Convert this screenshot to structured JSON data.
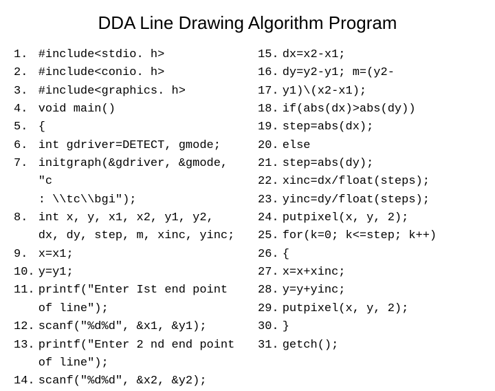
{
  "title": "DDA Line Drawing Algorithm Program",
  "left": [
    {
      "n": "1",
      "code": "#include<stdio. h>"
    },
    {
      "n": "2",
      "code": "#include<conio. h>"
    },
    {
      "n": "3",
      "code": "#include<graphics. h>"
    },
    {
      "n": "4",
      "code": "void main()"
    },
    {
      "n": "5",
      "code": "{"
    },
    {
      "n": "6",
      "code": "int gdriver=DETECT, gmode;"
    },
    {
      "n": "7",
      "code": "initgraph(&gdriver, &gmode, \"c",
      "cont": ": \\\\tc\\\\bgi\");"
    },
    {
      "n": "8",
      "code": "int x, y, x1, x2, y1, y2,",
      "cont": "dx, dy, step, m, xinc, yinc;"
    },
    {
      "n": "9",
      "code": "x=x1;"
    },
    {
      "n": "10",
      "code": "y=y1;"
    },
    {
      "n": "11",
      "code": "printf(\"Enter Ist end point",
      "cont": "of line\");"
    },
    {
      "n": "12",
      "code": "scanf(\"%d%d\", &x1, &y1);"
    },
    {
      "n": "13",
      "code": "printf(\"Enter 2 nd end point",
      "cont": "of line\");"
    },
    {
      "n": "14",
      "code": "scanf(\"%d%d\", &x2, &y2);"
    }
  ],
  "right": [
    {
      "n": "15",
      "code": "dx=x2-x1;"
    },
    {
      "n": "16",
      "code": "dy=y2-y1; m=(y2-"
    },
    {
      "n": "17",
      "code": "y1)\\(x2-x1);"
    },
    {
      "n": "18",
      "code": "if(abs(dx)>abs(dy))"
    },
    {
      "n": "19",
      "code": "step=abs(dx);"
    },
    {
      "n": "20",
      "code": "else"
    },
    {
      "n": "21",
      "code": "step=abs(dy);"
    },
    {
      "n": "22",
      "code": "xinc=dx/float(steps);"
    },
    {
      "n": "23",
      "code": "yinc=dy/float(steps);"
    },
    {
      "n": "24",
      "code": "putpixel(x, y, 2);"
    },
    {
      "n": "25",
      "code": "for(k=0; k<=step; k++)"
    },
    {
      "n": "26",
      "code": "{"
    },
    {
      "n": "27",
      "code": "x=x+xinc;"
    },
    {
      "n": "28",
      "code": "y=y+yinc;"
    },
    {
      "n": "29",
      "code": "putpixel(x, y, 2);"
    },
    {
      "n": "30",
      "code": "}"
    },
    {
      "n": "31",
      "code": "getch();"
    }
  ]
}
